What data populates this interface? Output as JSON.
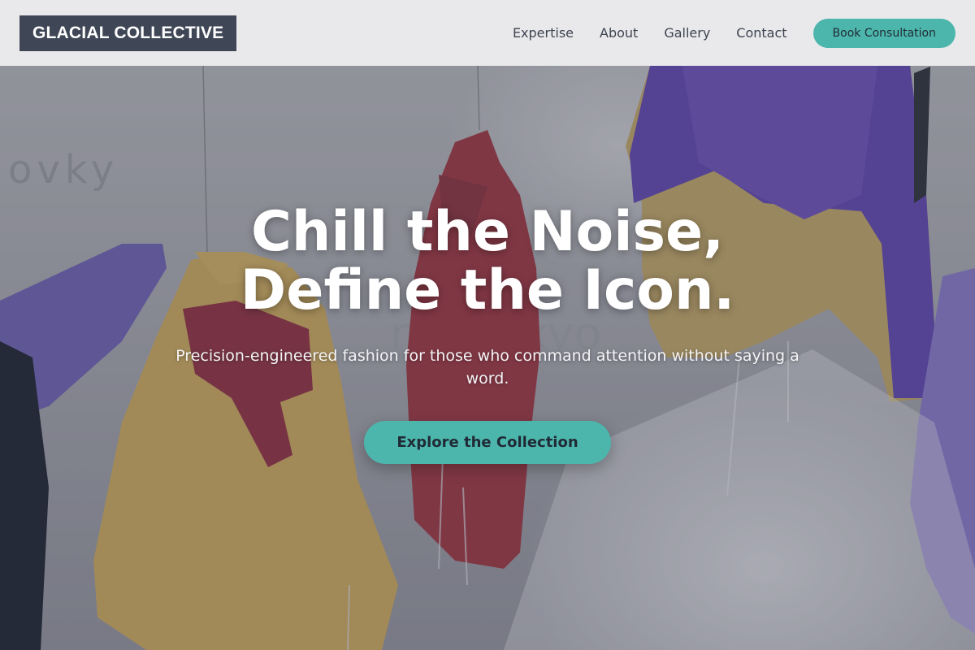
{
  "brand": {
    "name": "GLACIAL COLLECTIVE"
  },
  "nav": {
    "links": [
      "Expertise",
      "About",
      "Gallery",
      "Contact"
    ],
    "cta_label": "Book Consultation"
  },
  "hero": {
    "title_line_1": "Chill the Noise,",
    "title_line_2": "Define the Icon.",
    "subtitle": "Precision-engineered fashion for those who command attention without saying a word.",
    "button_label": "Explore the Collection",
    "background_watermark": "ovky",
    "background_watermark_2": "mo tokyo"
  },
  "colors": {
    "accent": "#4db6ac",
    "logo_bg": "#3f4756",
    "header_bg": "#ececee",
    "nav_text": "#3d4350"
  }
}
